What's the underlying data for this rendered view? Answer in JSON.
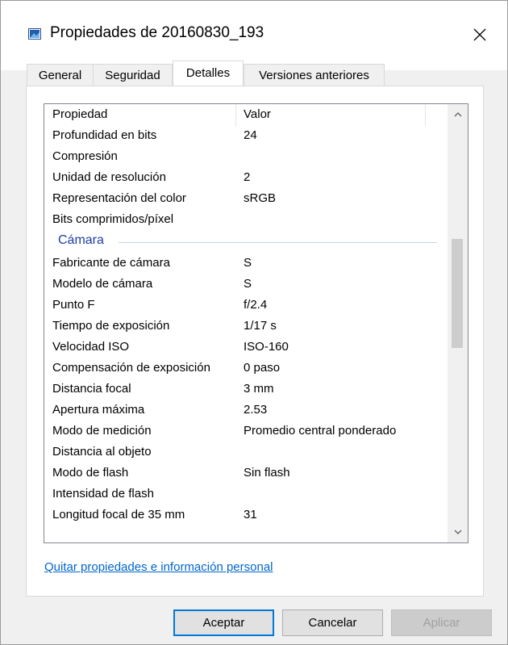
{
  "window": {
    "title": "Propiedades de 20160830_193"
  },
  "tabs": [
    {
      "label": "General"
    },
    {
      "label": "Seguridad"
    },
    {
      "label": "Detalles"
    },
    {
      "label": "Versiones anteriores"
    }
  ],
  "active_tab": "Detalles",
  "table": {
    "columns": {
      "property": "Propiedad",
      "value": "Valor"
    },
    "rows_top": [
      {
        "property": "Profundidad en bits",
        "value": "24"
      },
      {
        "property": "Compresión",
        "value": ""
      },
      {
        "property": "Unidad de resolución",
        "value": "2"
      },
      {
        "property": "Representación del color",
        "value": "sRGB"
      },
      {
        "property": "Bits comprimidos/píxel",
        "value": ""
      }
    ],
    "group_label": "Cámara",
    "rows_camera": [
      {
        "property": "Fabricante de cámara",
        "value": "S"
      },
      {
        "property": "Modelo de cámara",
        "value": "S"
      },
      {
        "property": "Punto F",
        "value": "f/2.4"
      },
      {
        "property": "Tiempo de exposición",
        "value": "1/17 s"
      },
      {
        "property": "Velocidad ISO",
        "value": "ISO-160"
      },
      {
        "property": "Compensación de exposición",
        "value": "0 paso"
      },
      {
        "property": "Distancia focal",
        "value": "3 mm"
      },
      {
        "property": "Apertura máxima",
        "value": "2.53"
      },
      {
        "property": "Modo de medición",
        "value": "Promedio central ponderado"
      },
      {
        "property": "Distancia al objeto",
        "value": ""
      },
      {
        "property": "Modo de flash",
        "value": "Sin flash"
      },
      {
        "property": "Intensidad de flash",
        "value": ""
      },
      {
        "property": "Longitud focal de 35 mm",
        "value": "31"
      }
    ]
  },
  "link": "Quitar propiedades e información personal",
  "buttons": {
    "ok": "Aceptar",
    "cancel": "Cancelar",
    "apply": "Aplicar"
  }
}
